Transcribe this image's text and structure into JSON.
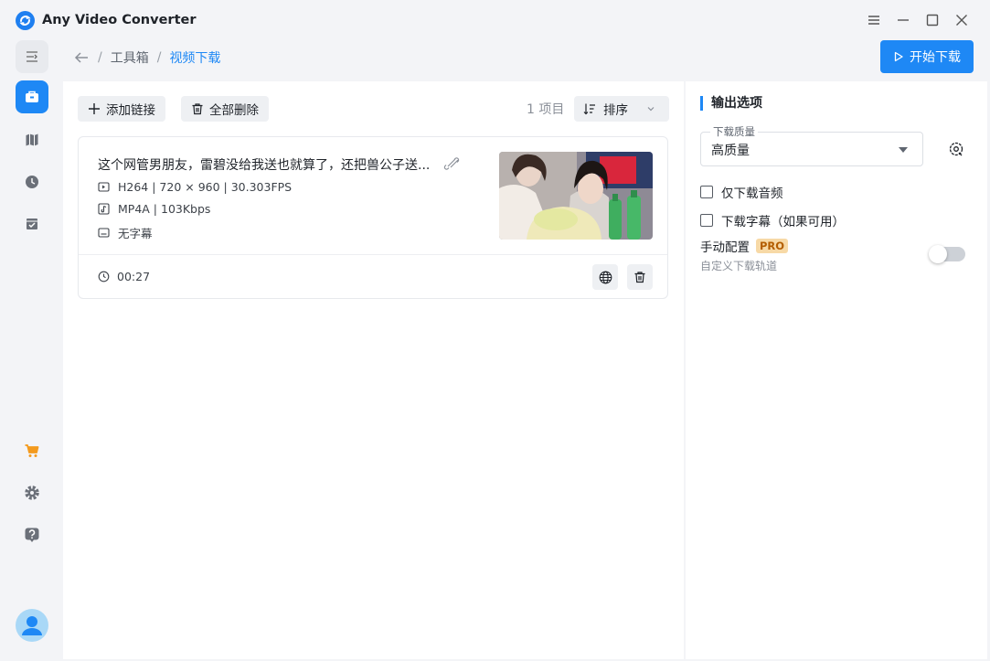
{
  "app": {
    "title": "Any Video Converter"
  },
  "breadcrumb": {
    "home": "工具箱",
    "current": "视频下载"
  },
  "header": {
    "start_label": "开始下载"
  },
  "toolbar": {
    "add_link": "添加链接",
    "delete_all": "全部删除",
    "count": "1 项目",
    "sort": "排序"
  },
  "video": {
    "title": "这个网管男朋友，雷碧没给我送也就算了，还把兽公子送...",
    "video_info": "H264 | 720 × 960 | 30.303FPS",
    "audio_info": "MP4A | 103Kbps",
    "subtitle_info": "无字幕",
    "duration": "00:27"
  },
  "output": {
    "title": "输出选项",
    "quality_label": "下载质量",
    "quality_value": "高质量",
    "audio_only": "仅下载音频",
    "subtitles": "下载字幕（如果可用）",
    "manual": "手动配置",
    "pro": "PRO",
    "manual_desc": "自定义下载轨道"
  },
  "colors": {
    "accent": "#1e88f5",
    "pro_bg": "#f7d9a6"
  }
}
